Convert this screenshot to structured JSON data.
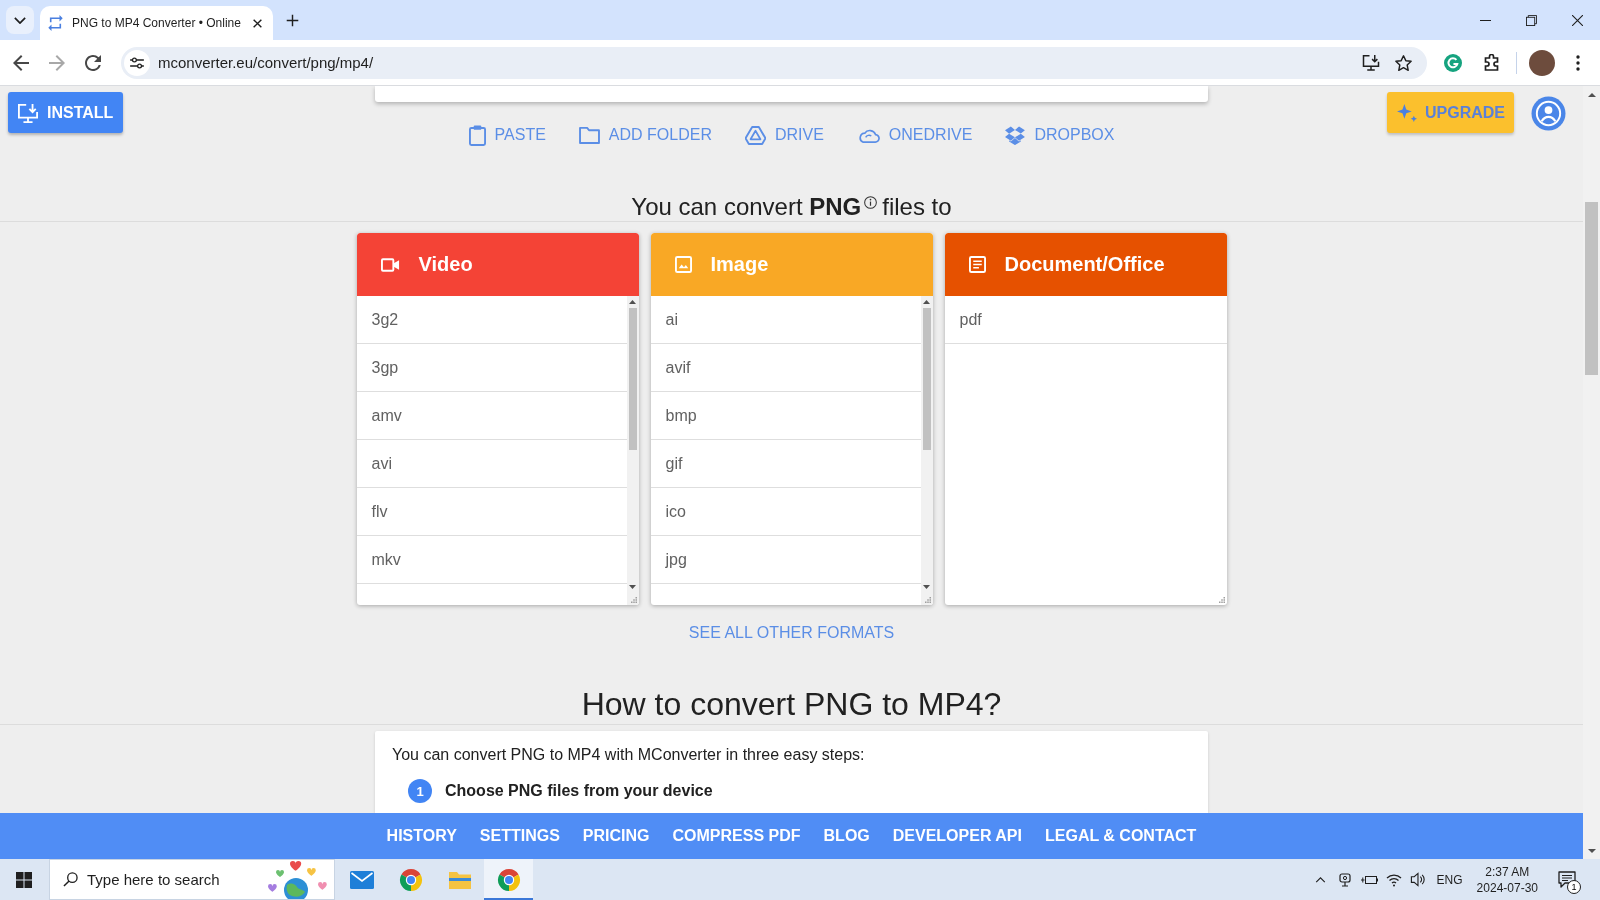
{
  "browser": {
    "tab": {
      "title": "PNG to MP4 Converter • Online",
      "selected": true
    },
    "nav": [
      {
        "kind": "back",
        "disabled": false
      },
      {
        "kind": "forward",
        "disabled": true
      },
      {
        "kind": "reload",
        "disabled": false
      }
    ],
    "address": "mconverter.eu/convert/png/mp4/"
  },
  "header": {
    "install": "INSTALL",
    "upgrade": "UPGRADE"
  },
  "sources": [
    {
      "kind": "paste",
      "label": "PASTE"
    },
    {
      "kind": "folder",
      "label": "ADD FOLDER"
    },
    {
      "kind": "drive",
      "label": "DRIVE"
    },
    {
      "kind": "onedrive",
      "label": "ONEDRIVE"
    },
    {
      "kind": "dropbox",
      "label": "DROPBOX"
    }
  ],
  "convert_heading": {
    "text": "You can convert **PNG**",
    "continuation": "files to"
  },
  "categories": [
    {
      "kind": "video",
      "title": "Video",
      "color": "#f44336",
      "scrollable": true,
      "formats": [
        "3g2",
        "3gp",
        "amv",
        "avi",
        "flv",
        "mkv"
      ]
    },
    {
      "kind": "image",
      "title": "Image",
      "color": "#f9a825",
      "scrollable": true,
      "formats": [
        "ai",
        "avif",
        "bmp",
        "gif",
        "ico",
        "jpg"
      ]
    },
    {
      "kind": "document",
      "title": "Document/Office",
      "color": "#e65100",
      "scrollable": false,
      "formats": [
        "pdf"
      ]
    }
  ],
  "see_all": "SEE ALL OTHER FORMATS",
  "howto": {
    "title": "How to convert PNG to MP4?",
    "intro": "You can convert PNG to MP4 with MConverter in three easy steps:",
    "steps": [
      {
        "number": "1",
        "text": "Choose PNG files from your device"
      }
    ]
  },
  "footer_nav": [
    "HISTORY",
    "SETTINGS",
    "PRICING",
    "COMPRESS PDF",
    "BLOG",
    "DEVELOPER API",
    "LEGAL & CONTACT"
  ],
  "taskbar": {
    "search": {
      "placeholder": "Type here to search"
    },
    "apps": [
      {
        "kind": "mail",
        "selected": false
      },
      {
        "kind": "browser",
        "selected": false
      },
      {
        "kind": "files",
        "selected": false
      },
      {
        "kind": "browser",
        "selected": true
      }
    ],
    "language": "ENG",
    "time": "2:37 AM",
    "date": "2024-07-30",
    "notifications": "1"
  }
}
